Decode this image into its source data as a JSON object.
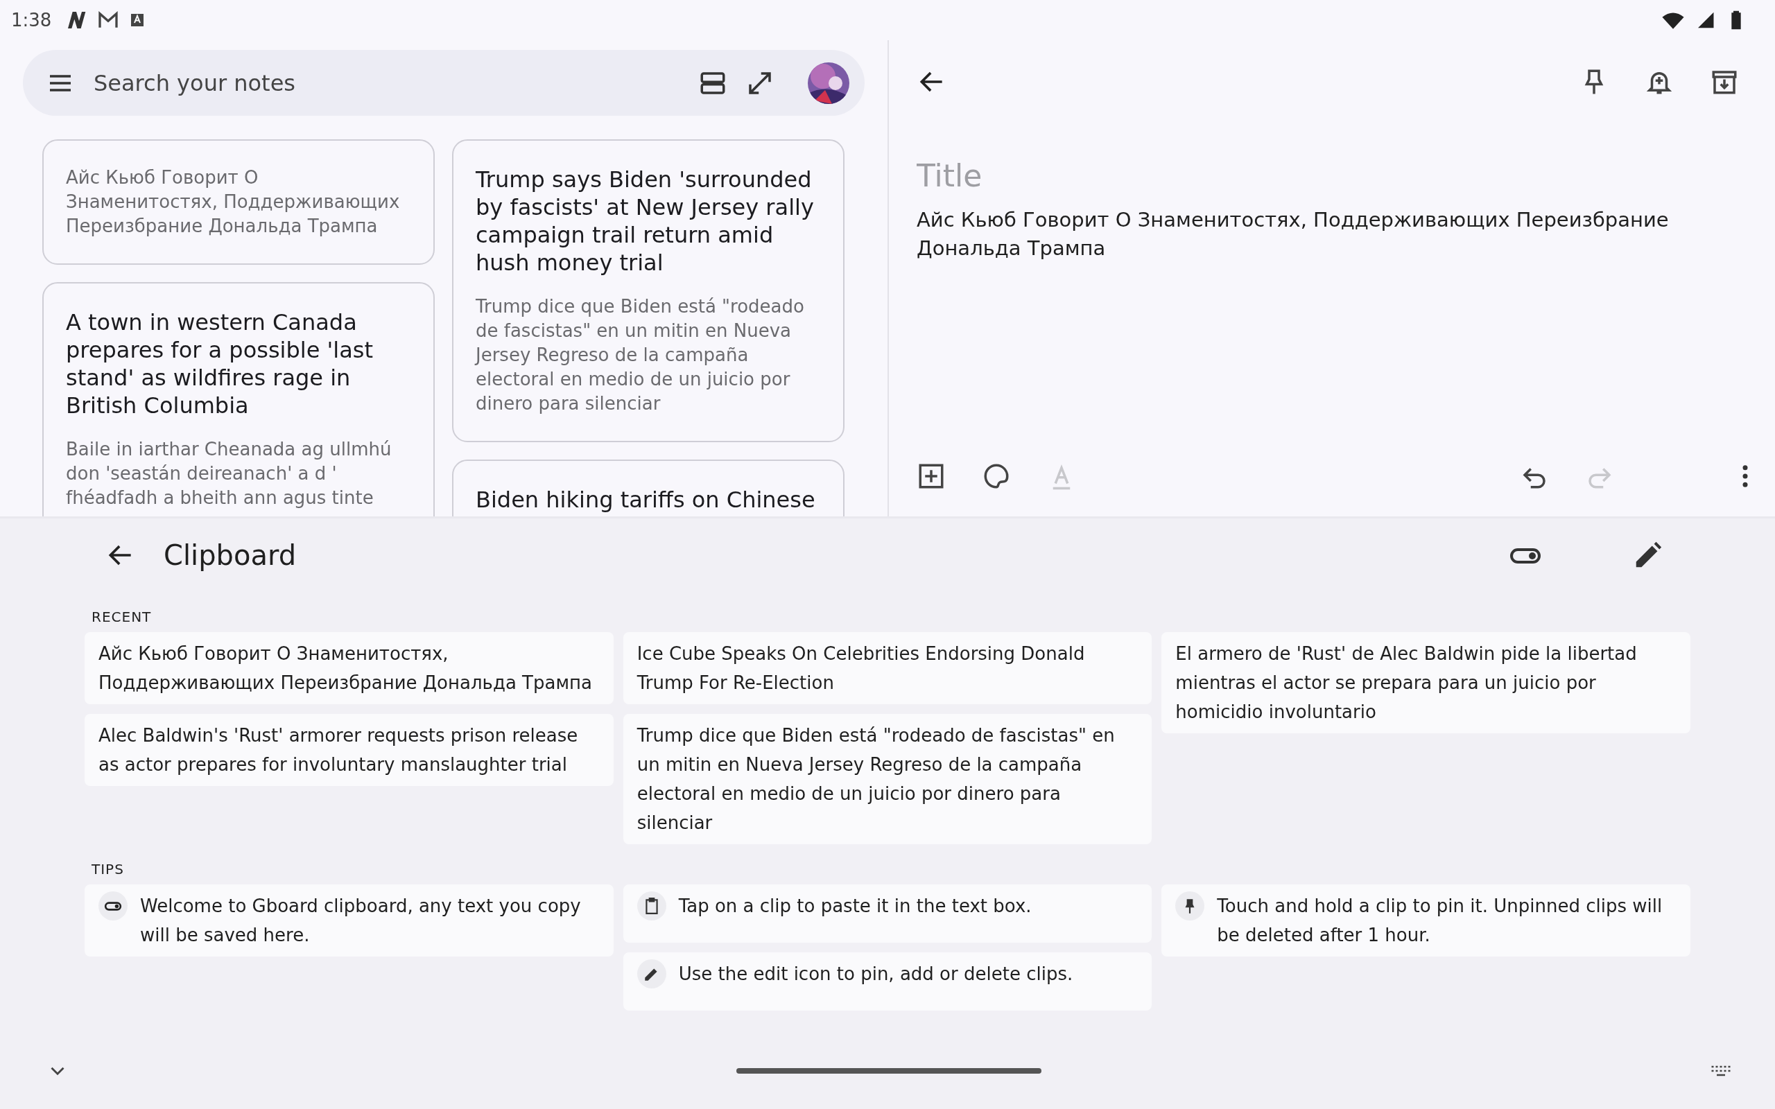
{
  "status_bar": {
    "time": "1:38"
  },
  "search": {
    "placeholder": "Search your notes"
  },
  "notes": [
    [
      {
        "body": "Айс Кьюб Говорит О Знаменитостях, Поддерживающих Переизбрание Дональда Трампа"
      },
      {
        "title": "A town in western Canada prepares for a possible 'last stand' as wildfires rage in British Columbia",
        "body": "Baile in iarthar Cheanada ag ullmhú don 'seastán deireanach' a d ' fhéadfadh a bheith ann agus tinte"
      }
    ],
    [
      {
        "title": "Trump says Biden 'surrounded by fascists' at New Jersey rally campaign trail return amid hush money trial",
        "body": "Trump dice que Biden está \"rodeado de fascistas\" en un mitin en Nueva Jersey Regreso de la campaña electoral en medio de un juicio por dinero para silenciar"
      },
      {
        "title": "Biden hiking tariffs on Chinese"
      }
    ]
  ],
  "editor": {
    "title": {
      "placeholder": "Title"
    },
    "body": "Айс Кьюб Говорит О Знаменитостях, Поддерживающих Переизбрание Дональда Трампа",
    "tools": [
      {
        "kind": "add",
        "disabled": false
      },
      {
        "kind": "palette",
        "disabled": false
      },
      {
        "kind": "format",
        "disabled": true
      },
      {
        "kind": "undo",
        "disabled": false
      },
      {
        "kind": "redo",
        "disabled": true
      }
    ]
  },
  "clipboard": {
    "title": "Clipboard",
    "sections": [
      {
        "heading": "RECENT",
        "columns": [
          [
            {
              "text": "Айс Кьюб Говорит О Знаменитостях, Поддерживающих Переизбрание Дональда Трампа"
            },
            {
              "text": "Alec Baldwin's 'Rust' armorer requests prison release as actor prepares for involuntary manslaughter trial"
            }
          ],
          [
            {
              "text": "Ice Cube Speaks On Celebrities Endorsing Donald Trump For Re-Election"
            },
            {
              "text": "Trump dice que Biden está \"rodeado de fascistas\" en un mitin en Nueva Jersey Regreso de la campaña electoral en medio de un juicio por dinero para silenciar"
            }
          ],
          [
            {
              "text": "El armero de 'Rust' de Alec Baldwin pide la libertad mientras el actor se prepara para un juicio por homicidio involuntario"
            }
          ]
        ]
      },
      {
        "heading": "TIPS",
        "columns": [
          [
            {
              "kind": "toggle",
              "text": "Welcome to Gboard clipboard, any text you copy will be saved here."
            }
          ],
          [
            {
              "kind": "clipboard",
              "text": "Tap on a clip to paste it in the text box."
            },
            {
              "kind": "edit",
              "text": "Use the edit icon to pin, add or delete clips."
            }
          ],
          [
            {
              "kind": "pin",
              "text": "Touch and hold a clip to pin it. Unpinned clips will be deleted after 1 hour."
            }
          ]
        ]
      }
    ]
  }
}
